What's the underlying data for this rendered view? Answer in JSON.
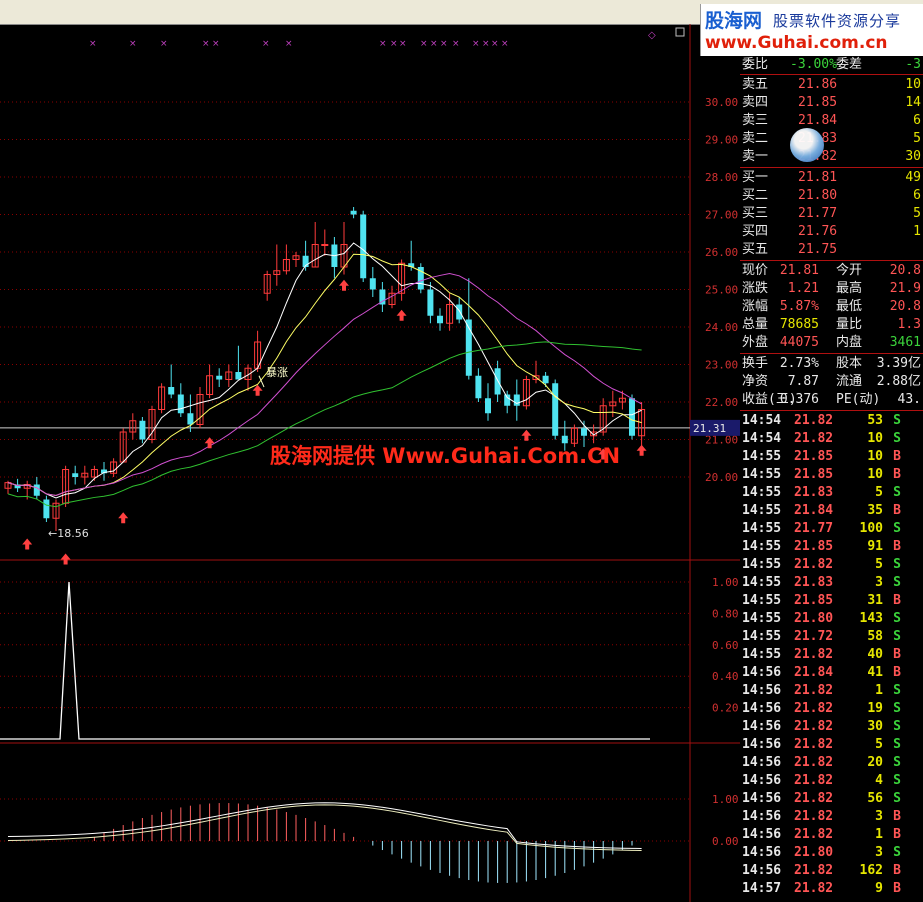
{
  "logo": {
    "brand": "股海网",
    "slogan": "股票软件资源分享",
    "site": "www.Guhai.com.cn"
  },
  "watermark": "股海网提供 Www.Guhai.Com.CN",
  "chart": {
    "price_axis": [
      "30.00",
      "29.00",
      "28.00",
      "27.00",
      "26.00",
      "25.00",
      "24.00",
      "23.00",
      "22.00",
      "21.00",
      "20.00"
    ],
    "current_price_tag": "21.31",
    "low_label": "←18.56",
    "signal_label": "暴涨",
    "ind1_axis": [
      "1.00",
      "0.80",
      "0.60",
      "0.40",
      "0.20"
    ],
    "macd_axis": [
      "1.00",
      "0.00"
    ],
    "colors": {
      "up": "#ff3b3b",
      "down": "#4fe3f0",
      "ma5": "#ffffff",
      "ma10": "#ffff66",
      "ma20": "#d050d0",
      "ma60": "#30c030",
      "grid": "#8b0000"
    }
  },
  "chart_data": {
    "type": "candlestick",
    "ylim": [
      18.5,
      30.5
    ],
    "candles": [
      [
        19.7,
        19.9,
        19.55,
        19.85
      ],
      [
        19.8,
        19.95,
        19.6,
        19.7
      ],
      [
        19.7,
        19.9,
        19.4,
        19.8
      ],
      [
        19.8,
        20.0,
        19.4,
        19.5
      ],
      [
        19.4,
        19.5,
        18.8,
        18.9
      ],
      [
        18.9,
        19.4,
        18.56,
        19.3
      ],
      [
        19.3,
        20.3,
        19.2,
        20.2
      ],
      [
        20.1,
        20.3,
        19.8,
        20.0
      ],
      [
        20.0,
        20.3,
        19.8,
        20.1
      ],
      [
        20.0,
        20.3,
        19.9,
        20.2
      ],
      [
        20.2,
        20.4,
        19.9,
        20.1
      ],
      [
        20.1,
        20.5,
        20.0,
        20.4
      ],
      [
        20.4,
        21.3,
        20.4,
        21.2
      ],
      [
        21.2,
        21.7,
        21.0,
        21.5
      ],
      [
        21.5,
        21.6,
        20.9,
        21.0
      ],
      [
        21.0,
        21.9,
        20.9,
        21.8
      ],
      [
        21.8,
        22.5,
        21.7,
        22.4
      ],
      [
        22.4,
        23.0,
        22.1,
        22.2
      ],
      [
        22.2,
        22.5,
        21.6,
        21.7
      ],
      [
        21.7,
        22.2,
        21.2,
        21.4
      ],
      [
        21.4,
        22.4,
        21.3,
        22.2
      ],
      [
        22.2,
        23.0,
        22.1,
        22.7
      ],
      [
        22.7,
        22.9,
        22.4,
        22.6
      ],
      [
        22.6,
        23.0,
        22.4,
        22.8
      ],
      [
        22.8,
        23.5,
        22.6,
        22.6
      ],
      [
        22.6,
        23.0,
        22.3,
        22.9
      ],
      [
        22.9,
        23.9,
        22.8,
        23.6
      ],
      [
        24.9,
        25.5,
        24.7,
        25.4
      ],
      [
        25.4,
        26.2,
        25.1,
        25.5
      ],
      [
        25.5,
        26.2,
        25.4,
        25.8
      ],
      [
        25.8,
        26.0,
        25.6,
        25.9
      ],
      [
        25.9,
        26.3,
        25.5,
        25.6
      ],
      [
        25.6,
        26.8,
        25.6,
        26.2
      ],
      [
        26.2,
        26.6,
        25.9,
        26.2
      ],
      [
        26.2,
        26.4,
        25.3,
        25.6
      ],
      [
        25.6,
        26.8,
        25.4,
        26.2
      ],
      [
        27.1,
        27.2,
        26.9,
        27.0
      ],
      [
        27.0,
        27.1,
        25.2,
        25.3
      ],
      [
        25.3,
        25.6,
        24.8,
        25.0
      ],
      [
        25.0,
        25.2,
        24.4,
        24.6
      ],
      [
        24.6,
        25.1,
        24.5,
        24.9
      ],
      [
        24.9,
        25.8,
        24.7,
        25.7
      ],
      [
        25.7,
        26.3,
        25.5,
        25.6
      ],
      [
        25.6,
        25.7,
        24.9,
        25.0
      ],
      [
        25.0,
        25.2,
        24.1,
        24.3
      ],
      [
        24.3,
        24.5,
        23.9,
        24.1
      ],
      [
        24.1,
        24.9,
        23.9,
        24.6
      ],
      [
        24.6,
        24.8,
        24.1,
        24.2
      ],
      [
        24.2,
        25.3,
        22.6,
        22.7
      ],
      [
        22.7,
        22.9,
        22.0,
        22.1
      ],
      [
        22.1,
        22.5,
        21.5,
        21.7
      ],
      [
        22.9,
        23.1,
        22.0,
        22.2
      ],
      [
        22.2,
        22.3,
        21.7,
        21.9
      ],
      [
        22.2,
        22.6,
        21.5,
        21.9
      ],
      [
        21.9,
        22.7,
        21.8,
        22.6
      ],
      [
        22.6,
        23.1,
        22.5,
        22.7
      ],
      [
        22.7,
        22.8,
        22.4,
        22.5
      ],
      [
        22.5,
        22.6,
        21.0,
        21.1
      ],
      [
        21.1,
        21.5,
        20.7,
        20.9
      ],
      [
        20.9,
        21.4,
        20.8,
        21.3
      ],
      [
        21.3,
        21.5,
        20.8,
        21.1
      ],
      [
        21.1,
        21.4,
        20.9,
        21.2
      ],
      [
        21.2,
        22.1,
        21.1,
        21.9
      ],
      [
        21.9,
        22.3,
        21.6,
        22.0
      ],
      [
        22.0,
        22.3,
        21.8,
        22.1
      ],
      [
        22.1,
        22.2,
        21.0,
        21.1
      ],
      [
        21.1,
        22.0,
        20.6,
        21.8
      ]
    ]
  },
  "quote": {
    "ratio": {
      "label": "委比",
      "val": "-3.00%",
      "label2": "委差",
      "val2": "-3"
    },
    "sell": [
      {
        "label": "卖五",
        "price": "21.86",
        "vol": "10"
      },
      {
        "label": "卖四",
        "price": "21.85",
        "vol": "14"
      },
      {
        "label": "卖三",
        "price": "21.84",
        "vol": "6"
      },
      {
        "label": "卖二",
        "price": "21.83",
        "vol": "5"
      },
      {
        "label": "卖一",
        "price": "21.82",
        "vol": "30"
      }
    ],
    "buy": [
      {
        "label": "买一",
        "price": "21.81",
        "vol": "49"
      },
      {
        "label": "买二",
        "price": "21.80",
        "vol": "6"
      },
      {
        "label": "买三",
        "price": "21.77",
        "vol": "5"
      },
      {
        "label": "买四",
        "price": "21.76",
        "vol": "1"
      },
      {
        "label": "买五",
        "price": "21.75",
        "vol": ""
      }
    ],
    "stats": [
      {
        "l1": "现价",
        "v1": "21.81",
        "l2": "今开",
        "v2": "20.8"
      },
      {
        "l1": "涨跌",
        "v1": "1.21",
        "l2": "最高",
        "v2": "21.9"
      },
      {
        "l1": "涨幅",
        "v1": "5.87%",
        "l2": "最低",
        "v2": "20.8"
      },
      {
        "l1": "总量",
        "v1": "78685",
        "l2": "量比",
        "v2": "1.3"
      },
      {
        "l1": "外盘",
        "v1": "44075",
        "l2": "内盘",
        "v2": "3461"
      }
    ],
    "fund": [
      {
        "l1": "换手",
        "v1": "2.73%",
        "l2": "股本",
        "v2": "3.39亿"
      },
      {
        "l1": "净资",
        "v1": "7.87",
        "l2": "流通",
        "v2": "2.88亿"
      },
      {
        "l1": "收益(三)",
        "v1": "0.376",
        "l2": "PE(动)",
        "v2": "43."
      }
    ]
  },
  "ticks": [
    {
      "t": "14:54",
      "p": "21.82",
      "v": "53",
      "bs": "S"
    },
    {
      "t": "14:54",
      "p": "21.82",
      "v": "10",
      "bs": "S"
    },
    {
      "t": "14:55",
      "p": "21.85",
      "v": "10",
      "bs": "B"
    },
    {
      "t": "14:55",
      "p": "21.85",
      "v": "10",
      "bs": "B"
    },
    {
      "t": "14:55",
      "p": "21.83",
      "v": "5",
      "bs": "S"
    },
    {
      "t": "14:55",
      "p": "21.84",
      "v": "35",
      "bs": "B"
    },
    {
      "t": "14:55",
      "p": "21.77",
      "v": "100",
      "bs": "S"
    },
    {
      "t": "14:55",
      "p": "21.85",
      "v": "91",
      "bs": "B"
    },
    {
      "t": "14:55",
      "p": "21.82",
      "v": "5",
      "bs": "S"
    },
    {
      "t": "14:55",
      "p": "21.83",
      "v": "3",
      "bs": "S"
    },
    {
      "t": "14:55",
      "p": "21.85",
      "v": "31",
      "bs": "B"
    },
    {
      "t": "14:55",
      "p": "21.80",
      "v": "143",
      "bs": "S"
    },
    {
      "t": "14:55",
      "p": "21.72",
      "v": "58",
      "bs": "S"
    },
    {
      "t": "14:55",
      "p": "21.82",
      "v": "40",
      "bs": "B"
    },
    {
      "t": "14:56",
      "p": "21.84",
      "v": "41",
      "bs": "B"
    },
    {
      "t": "14:56",
      "p": "21.82",
      "v": "1",
      "bs": "S"
    },
    {
      "t": "14:56",
      "p": "21.82",
      "v": "19",
      "bs": "S"
    },
    {
      "t": "14:56",
      "p": "21.82",
      "v": "30",
      "bs": "S"
    },
    {
      "t": "14:56",
      "p": "21.82",
      "v": "5",
      "bs": "S"
    },
    {
      "t": "14:56",
      "p": "21.82",
      "v": "20",
      "bs": "S"
    },
    {
      "t": "14:56",
      "p": "21.82",
      "v": "4",
      "bs": "S"
    },
    {
      "t": "14:56",
      "p": "21.82",
      "v": "56",
      "bs": "S"
    },
    {
      "t": "14:56",
      "p": "21.82",
      "v": "3",
      "bs": "B"
    },
    {
      "t": "14:56",
      "p": "21.82",
      "v": "1",
      "bs": "B"
    },
    {
      "t": "14:56",
      "p": "21.80",
      "v": "3",
      "bs": "S"
    },
    {
      "t": "14:56",
      "p": "21.82",
      "v": "162",
      "bs": "B"
    },
    {
      "t": "14:57",
      "p": "21.82",
      "v": "9",
      "bs": "B"
    }
  ]
}
